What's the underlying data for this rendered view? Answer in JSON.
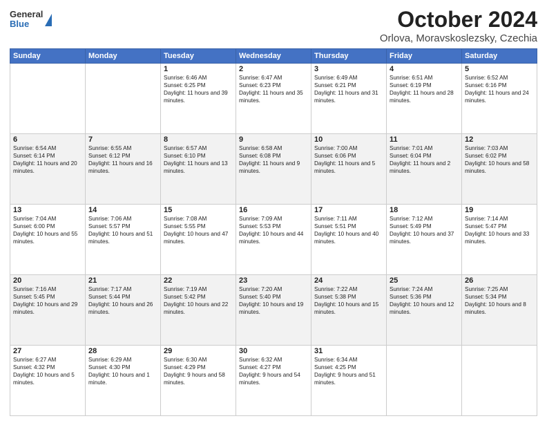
{
  "header": {
    "logo": {
      "line1": "General",
      "line2": "Blue"
    },
    "title": "October 2024",
    "subtitle": "Orlova, Moravskoslezsky, Czechia"
  },
  "days": [
    "Sunday",
    "Monday",
    "Tuesday",
    "Wednesday",
    "Thursday",
    "Friday",
    "Saturday"
  ],
  "weeks": [
    [
      {
        "day": "",
        "content": ""
      },
      {
        "day": "",
        "content": ""
      },
      {
        "day": "1",
        "content": "Sunrise: 6:46 AM\nSunset: 6:25 PM\nDaylight: 11 hours and 39 minutes."
      },
      {
        "day": "2",
        "content": "Sunrise: 6:47 AM\nSunset: 6:23 PM\nDaylight: 11 hours and 35 minutes."
      },
      {
        "day": "3",
        "content": "Sunrise: 6:49 AM\nSunset: 6:21 PM\nDaylight: 11 hours and 31 minutes."
      },
      {
        "day": "4",
        "content": "Sunrise: 6:51 AM\nSunset: 6:19 PM\nDaylight: 11 hours and 28 minutes."
      },
      {
        "day": "5",
        "content": "Sunrise: 6:52 AM\nSunset: 6:16 PM\nDaylight: 11 hours and 24 minutes."
      }
    ],
    [
      {
        "day": "6",
        "content": "Sunrise: 6:54 AM\nSunset: 6:14 PM\nDaylight: 11 hours and 20 minutes."
      },
      {
        "day": "7",
        "content": "Sunrise: 6:55 AM\nSunset: 6:12 PM\nDaylight: 11 hours and 16 minutes."
      },
      {
        "day": "8",
        "content": "Sunrise: 6:57 AM\nSunset: 6:10 PM\nDaylight: 11 hours and 13 minutes."
      },
      {
        "day": "9",
        "content": "Sunrise: 6:58 AM\nSunset: 6:08 PM\nDaylight: 11 hours and 9 minutes."
      },
      {
        "day": "10",
        "content": "Sunrise: 7:00 AM\nSunset: 6:06 PM\nDaylight: 11 hours and 5 minutes."
      },
      {
        "day": "11",
        "content": "Sunrise: 7:01 AM\nSunset: 6:04 PM\nDaylight: 11 hours and 2 minutes."
      },
      {
        "day": "12",
        "content": "Sunrise: 7:03 AM\nSunset: 6:02 PM\nDaylight: 10 hours and 58 minutes."
      }
    ],
    [
      {
        "day": "13",
        "content": "Sunrise: 7:04 AM\nSunset: 6:00 PM\nDaylight: 10 hours and 55 minutes."
      },
      {
        "day": "14",
        "content": "Sunrise: 7:06 AM\nSunset: 5:57 PM\nDaylight: 10 hours and 51 minutes."
      },
      {
        "day": "15",
        "content": "Sunrise: 7:08 AM\nSunset: 5:55 PM\nDaylight: 10 hours and 47 minutes."
      },
      {
        "day": "16",
        "content": "Sunrise: 7:09 AM\nSunset: 5:53 PM\nDaylight: 10 hours and 44 minutes."
      },
      {
        "day": "17",
        "content": "Sunrise: 7:11 AM\nSunset: 5:51 PM\nDaylight: 10 hours and 40 minutes."
      },
      {
        "day": "18",
        "content": "Sunrise: 7:12 AM\nSunset: 5:49 PM\nDaylight: 10 hours and 37 minutes."
      },
      {
        "day": "19",
        "content": "Sunrise: 7:14 AM\nSunset: 5:47 PM\nDaylight: 10 hours and 33 minutes."
      }
    ],
    [
      {
        "day": "20",
        "content": "Sunrise: 7:16 AM\nSunset: 5:45 PM\nDaylight: 10 hours and 29 minutes."
      },
      {
        "day": "21",
        "content": "Sunrise: 7:17 AM\nSunset: 5:44 PM\nDaylight: 10 hours and 26 minutes."
      },
      {
        "day": "22",
        "content": "Sunrise: 7:19 AM\nSunset: 5:42 PM\nDaylight: 10 hours and 22 minutes."
      },
      {
        "day": "23",
        "content": "Sunrise: 7:20 AM\nSunset: 5:40 PM\nDaylight: 10 hours and 19 minutes."
      },
      {
        "day": "24",
        "content": "Sunrise: 7:22 AM\nSunset: 5:38 PM\nDaylight: 10 hours and 15 minutes."
      },
      {
        "day": "25",
        "content": "Sunrise: 7:24 AM\nSunset: 5:36 PM\nDaylight: 10 hours and 12 minutes."
      },
      {
        "day": "26",
        "content": "Sunrise: 7:25 AM\nSunset: 5:34 PM\nDaylight: 10 hours and 8 minutes."
      }
    ],
    [
      {
        "day": "27",
        "content": "Sunrise: 6:27 AM\nSunset: 4:32 PM\nDaylight: 10 hours and 5 minutes."
      },
      {
        "day": "28",
        "content": "Sunrise: 6:29 AM\nSunset: 4:30 PM\nDaylight: 10 hours and 1 minute."
      },
      {
        "day": "29",
        "content": "Sunrise: 6:30 AM\nSunset: 4:29 PM\nDaylight: 9 hours and 58 minutes."
      },
      {
        "day": "30",
        "content": "Sunrise: 6:32 AM\nSunset: 4:27 PM\nDaylight: 9 hours and 54 minutes."
      },
      {
        "day": "31",
        "content": "Sunrise: 6:34 AM\nSunset: 4:25 PM\nDaylight: 9 hours and 51 minutes."
      },
      {
        "day": "",
        "content": ""
      },
      {
        "day": "",
        "content": ""
      }
    ]
  ]
}
